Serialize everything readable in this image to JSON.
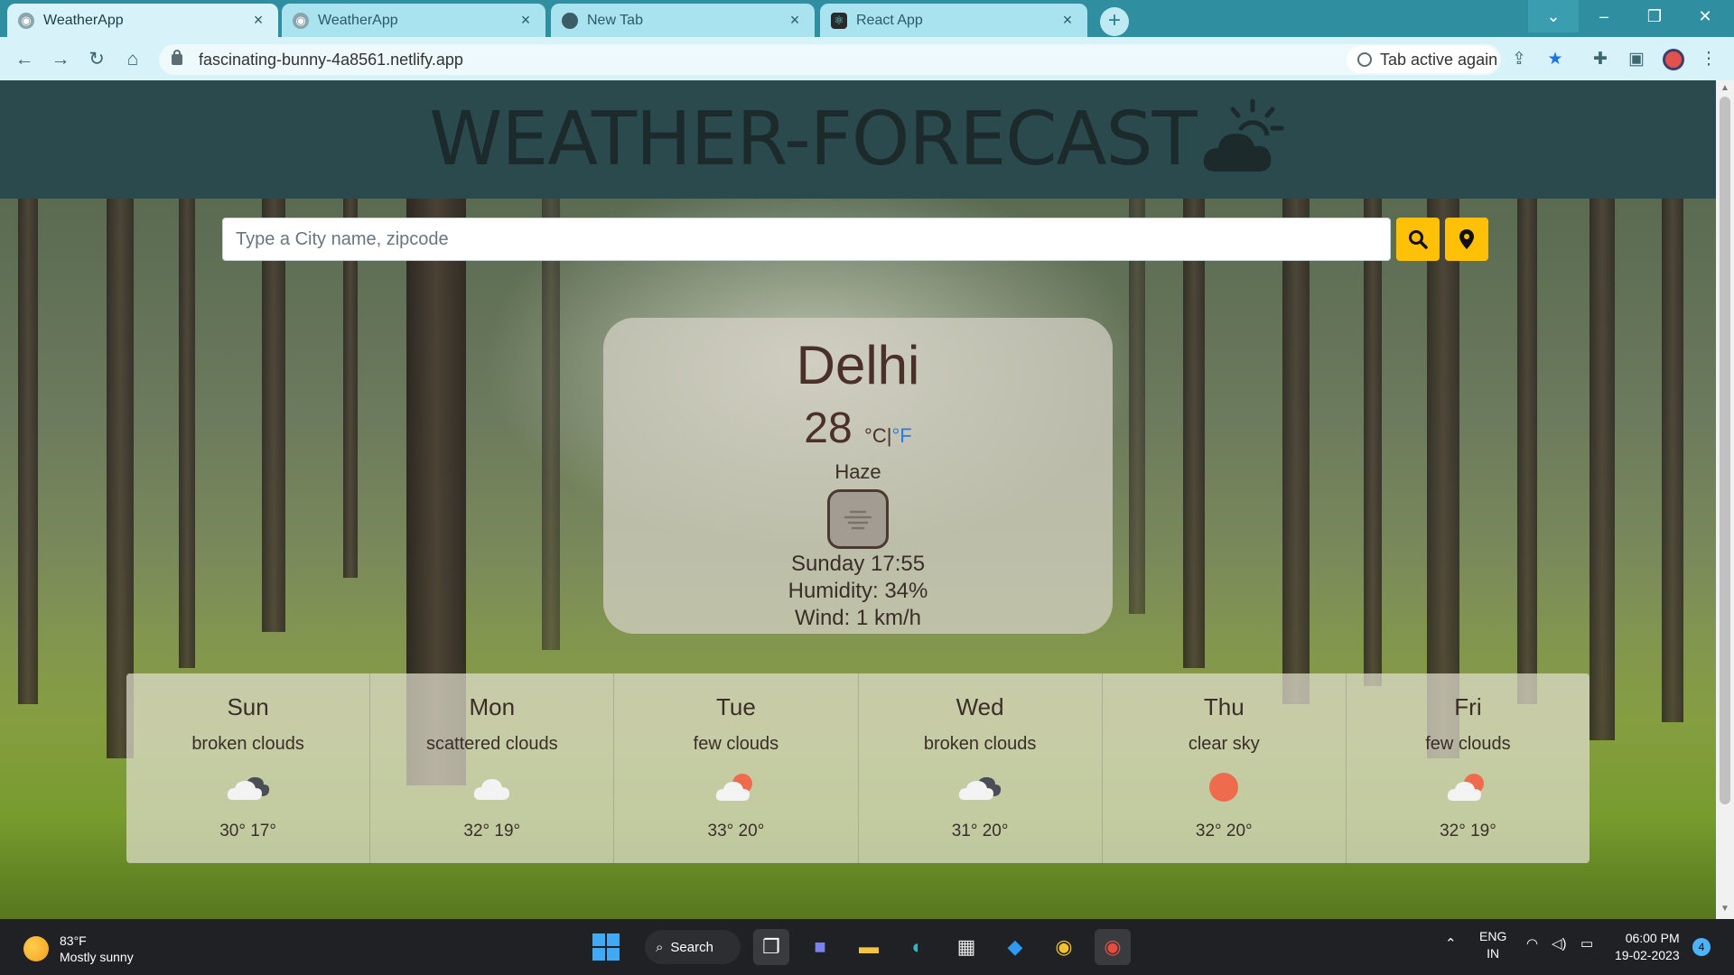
{
  "browser": {
    "tabs": [
      {
        "title": "WeatherApp",
        "active": true
      },
      {
        "title": "WeatherApp",
        "active": false
      },
      {
        "title": "New Tab",
        "active": false
      },
      {
        "title": "React App",
        "active": false
      }
    ],
    "url": "fascinating-bunny-4a8561.netlify.app",
    "chip_label": "Tab active again"
  },
  "page": {
    "heading": "WEATHER-FORECAST",
    "search_placeholder": "Type a City name, zipcode",
    "current": {
      "city": "Delhi",
      "temperature": "28",
      "unit_c": "°C",
      "unit_sep": "|",
      "unit_f": "°F",
      "condition": "Haze",
      "datetime": "Sunday 17:55",
      "humidity": "Humidity: 34%",
      "wind": "Wind: 1 km/h"
    },
    "forecast": [
      {
        "day": "Sun",
        "condition": "broken clouds",
        "icon": "broken-clouds-icon",
        "temps": "30° 17°"
      },
      {
        "day": "Mon",
        "condition": "scattered clouds",
        "icon": "scattered-clouds-icon",
        "temps": "32° 19°"
      },
      {
        "day": "Tue",
        "condition": "few clouds",
        "icon": "few-clouds-icon",
        "temps": "33° 20°"
      },
      {
        "day": "Wed",
        "condition": "broken clouds",
        "icon": "broken-clouds-icon",
        "temps": "31° 20°"
      },
      {
        "day": "Thu",
        "condition": "clear sky",
        "icon": "clear-sky-icon",
        "temps": "32° 20°"
      },
      {
        "day": "Fri",
        "condition": "few clouds",
        "icon": "few-clouds-icon",
        "temps": "32° 19°"
      }
    ],
    "colors": {
      "header_bg": "#2a4a4e",
      "button_yellow": "#ffc107",
      "fahrenheit_link": "#2d7be0"
    }
  },
  "taskbar": {
    "weather_temp": "83°F",
    "weather_desc": "Mostly sunny",
    "search_label": "Search",
    "lang_line1": "ENG",
    "lang_line2": "IN",
    "time": "06:00 PM",
    "date": "19-02-2023",
    "notifications": "4"
  }
}
